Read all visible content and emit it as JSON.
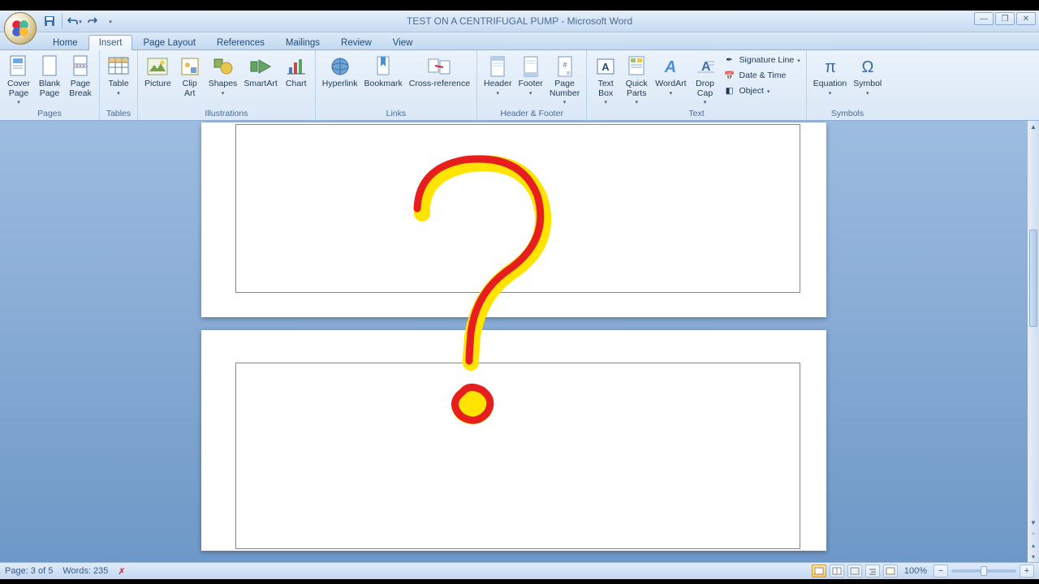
{
  "title": "TEST ON A CENTRIFUGAL PUMP - Microsoft Word",
  "tabs": [
    "Home",
    "Insert",
    "Page Layout",
    "References",
    "Mailings",
    "Review",
    "View"
  ],
  "active_tab": "Insert",
  "ribbon": {
    "pages": {
      "label": "Pages",
      "cover": "Cover\nPage",
      "blank": "Blank\nPage",
      "break": "Page\nBreak"
    },
    "tables": {
      "label": "Tables",
      "table": "Table"
    },
    "illustrations": {
      "label": "Illustrations",
      "picture": "Picture",
      "clipart": "Clip\nArt",
      "shapes": "Shapes",
      "smartart": "SmartArt",
      "chart": "Chart"
    },
    "links": {
      "label": "Links",
      "hyperlink": "Hyperlink",
      "bookmark": "Bookmark",
      "crossref": "Cross-reference"
    },
    "headerfooter": {
      "label": "Header & Footer",
      "header": "Header",
      "footer": "Footer",
      "pagenum": "Page\nNumber"
    },
    "text": {
      "label": "Text",
      "textbox": "Text\nBox",
      "quickparts": "Quick\nParts",
      "wordart": "WordArt",
      "dropcap": "Drop\nCap",
      "sig": "Signature Line",
      "date": "Date & Time",
      "object": "Object"
    },
    "symbols": {
      "label": "Symbols",
      "equation": "Equation",
      "symbol": "Symbol"
    }
  },
  "status": {
    "page": "Page: 3 of 5",
    "words": "Words: 235",
    "zoom": "100%"
  }
}
